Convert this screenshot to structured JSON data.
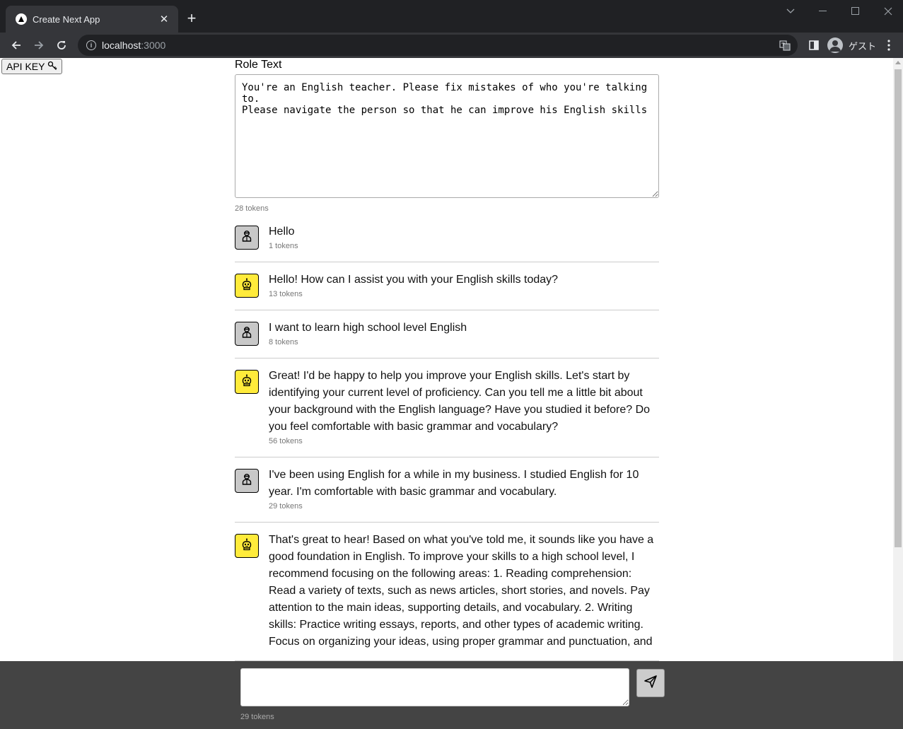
{
  "browser": {
    "tab_title": "Create Next App",
    "tab_close": "✕",
    "new_tab": "+",
    "url_host": "localhost",
    "url_port": ":3000",
    "profile_name": "ゲスト"
  },
  "page": {
    "api_key_label": "API KEY",
    "role_label": "Role Text",
    "role_text": "You're an English teacher. Please fix mistakes of who you're talking to.\nPlease navigate the person so that he can improve his English skills",
    "role_tokens": "28 tokens",
    "messages": [
      {
        "role": "user",
        "text": "Hello",
        "tokens": "1 tokens"
      },
      {
        "role": "assistant",
        "text": "Hello! How can I assist you with your English skills today?",
        "tokens": "13 tokens"
      },
      {
        "role": "user",
        "text": "I want to learn high school level English",
        "tokens": "8 tokens"
      },
      {
        "role": "assistant",
        "text": "Great! I'd be happy to help you improve your English skills. Let's start by identifying your current level of proficiency. Can you tell me a little bit about your background with the English language? Have you studied it before? Do you feel comfortable with basic grammar and vocabulary?",
        "tokens": "56 tokens"
      },
      {
        "role": "user",
        "text": "I've been using English for a while in my business. I studied English for 10 year. I'm comfortable with basic grammar and vocabulary.",
        "tokens": "29 tokens"
      },
      {
        "role": "assistant",
        "text": "That's great to hear! Based on what you've told me, it sounds like you have a good foundation in English. To improve your skills to a high school level, I recommend focusing on the following areas: 1. Reading comprehension: Read a variety of texts, such as news articles, short stories, and novels. Pay attention to the main ideas, supporting details, and vocabulary. 2. Writing skills: Practice writing essays, reports, and other types of academic writing. Focus on organizing your ideas, using proper grammar and punctuation, and",
        "tokens": ""
      }
    ]
  },
  "input": {
    "value": "",
    "tokens": "29 tokens"
  },
  "colors": {
    "user_avatar": "#c8c8c8",
    "bot_avatar": "#ffeb3b",
    "input_bar": "#444444"
  }
}
